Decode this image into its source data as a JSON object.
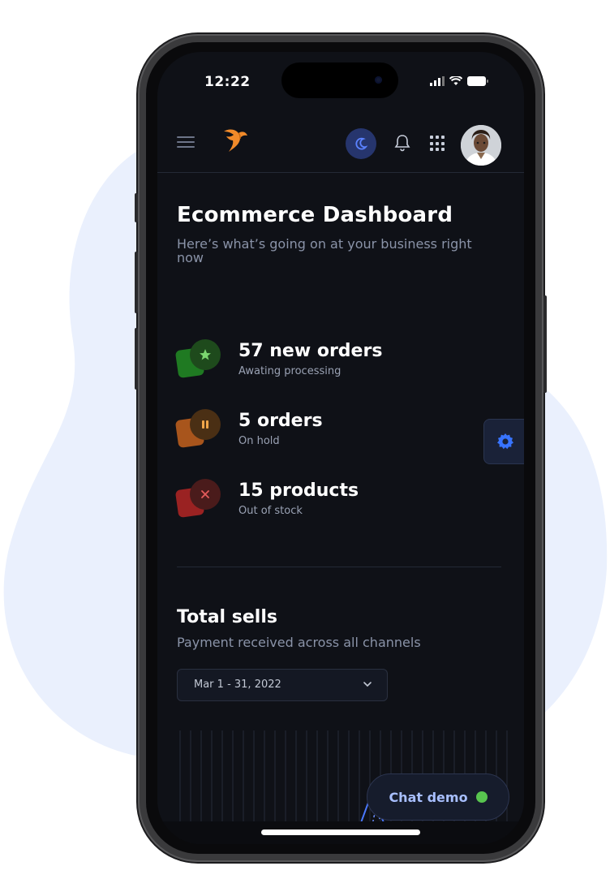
{
  "status_bar": {
    "time": "12:22"
  },
  "brand": {
    "accent": "#f08a2a",
    "theme_button_color": "#26356d"
  },
  "header": {
    "title": "Ecommerce Dashboard",
    "subtitle": "Here’s what’s going on at your business right now"
  },
  "stats": [
    {
      "label": "57 new orders",
      "sub": "Awating processing",
      "icon": "star-icon",
      "color": "#2e8b2e"
    },
    {
      "label": "5 orders",
      "sub": "On hold",
      "icon": "pause-icon",
      "color": "#c0651d"
    },
    {
      "label": "15 products",
      "sub": "Out of stock",
      "icon": "close-icon",
      "color": "#b02a2a"
    }
  ],
  "total_sells": {
    "title": "Total sells",
    "subtitle": "Payment received across all channels",
    "date_range": "Mar 1 - 31, 2022"
  },
  "chat": {
    "label": "Chat demo",
    "status_color": "#58c44f"
  },
  "icons": {
    "menu": "hamburger-icon",
    "theme": "moon-icon",
    "notifications": "bell-icon",
    "apps": "grid-icon",
    "settings": "gear-icon",
    "dropdown": "chevron-down-icon"
  }
}
